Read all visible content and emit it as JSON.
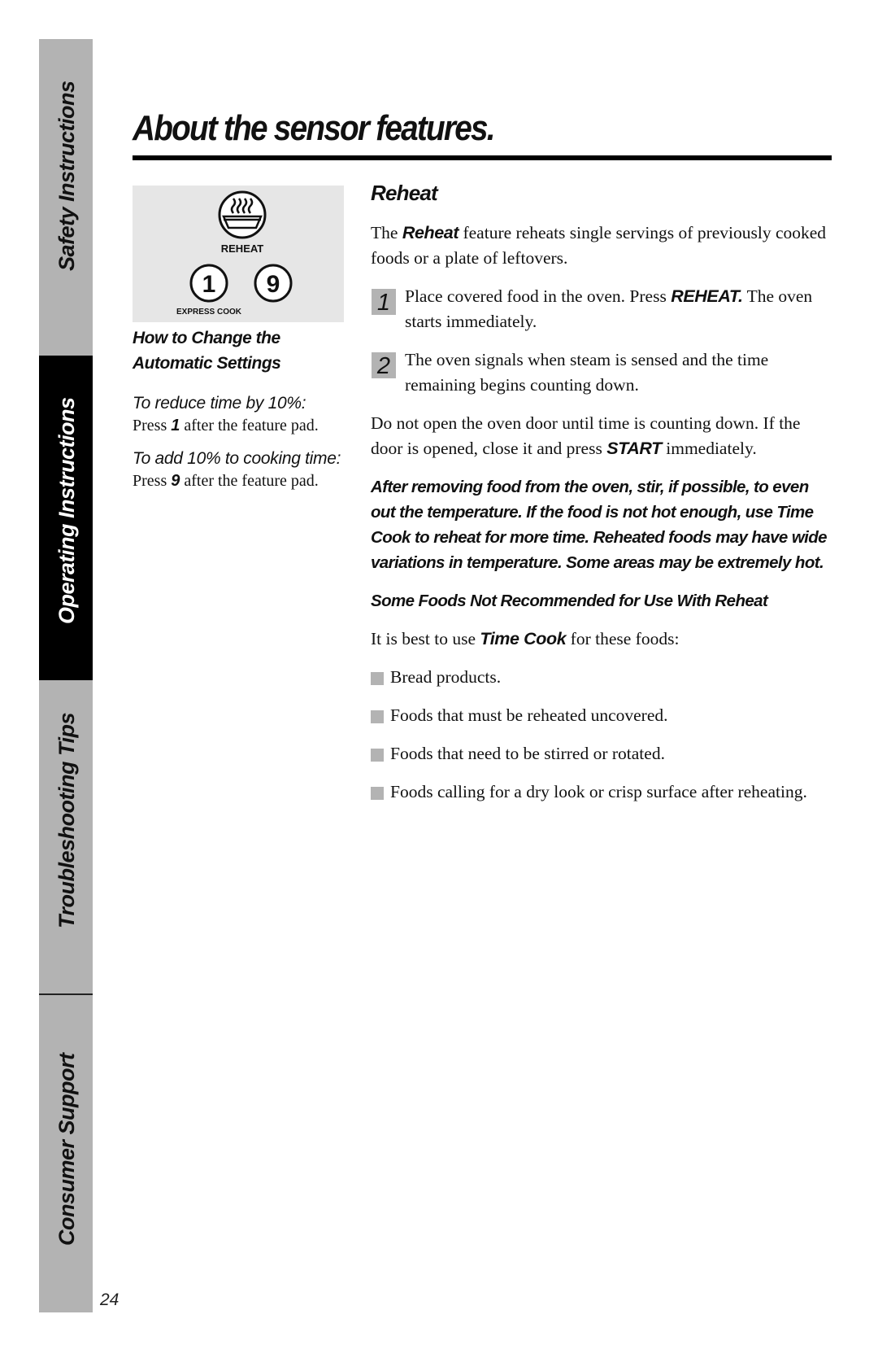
{
  "sidebar": {
    "tabs": [
      {
        "label": "Safety Instructions",
        "active": false
      },
      {
        "label": "Operating Instructions",
        "active": true
      },
      {
        "label": "Troubleshooting Tips",
        "active": false
      },
      {
        "label": "Consumer Support",
        "active": false
      }
    ]
  },
  "page_number": "24",
  "page_title": "About the sensor features.",
  "control_panel": {
    "reheat_pad_label": "REHEAT",
    "pad_1_label": "1",
    "pad_9_label": "9",
    "express_cook_label": "EXPRESS COOK",
    "icons": [
      "steaming-dish-icon"
    ]
  },
  "left_column": {
    "heading_line1": "How to Change the",
    "heading_line2": "Automatic Settings",
    "reduce": {
      "label": "To reduce time by 10%:",
      "text_pre": "Press ",
      "key": "1",
      "text_post": " after the feature pad."
    },
    "add": {
      "label": "To add 10% to cooking time:",
      "text_pre": "Press ",
      "key": "9",
      "text_post": " after the feature pad."
    }
  },
  "reheat": {
    "heading": "Reheat",
    "intro_pre": "The ",
    "intro_bold": "Reheat",
    "intro_post": "  feature reheats single servings of previously cooked foods or a plate of leftovers.",
    "steps": [
      {
        "num": "1",
        "text_pre": "Place covered food in the oven. Press ",
        "bold": "REHEAT.",
        "text_post": " The oven starts immediately."
      },
      {
        "num": "2",
        "text_pre": "The oven signals when steam is sensed and the time remaining begins counting down.",
        "bold": "",
        "text_post": ""
      }
    ],
    "door_note_pre": "Do not open the oven door until time is counting down. If the door is opened, close it and press ",
    "door_note_bold": "START",
    "door_note_post": " immediately.",
    "warning": "After removing food from the oven, stir, if possible, to even out the temperature. If the food is not hot enough, use Time Cook to reheat for more time. Reheated foods may have wide variations in temperature. Some areas may be extremely hot.",
    "not_recommended_heading": "Some Foods Not Recommended for Use With Reheat",
    "best_use_pre": "It is best to use ",
    "best_use_bold": "Time Cook",
    "best_use_post": " for these foods:",
    "foods": [
      "Bread products.",
      "Foods that must be reheated uncovered.",
      "Foods that need to be stirred or rotated.",
      "Foods calling for a dry look or crisp surface after reheating."
    ]
  },
  "colors": {
    "tab_gray": "#b3b3b3",
    "tab_active": "#000000",
    "panel_bg": "#e6e6e6"
  }
}
